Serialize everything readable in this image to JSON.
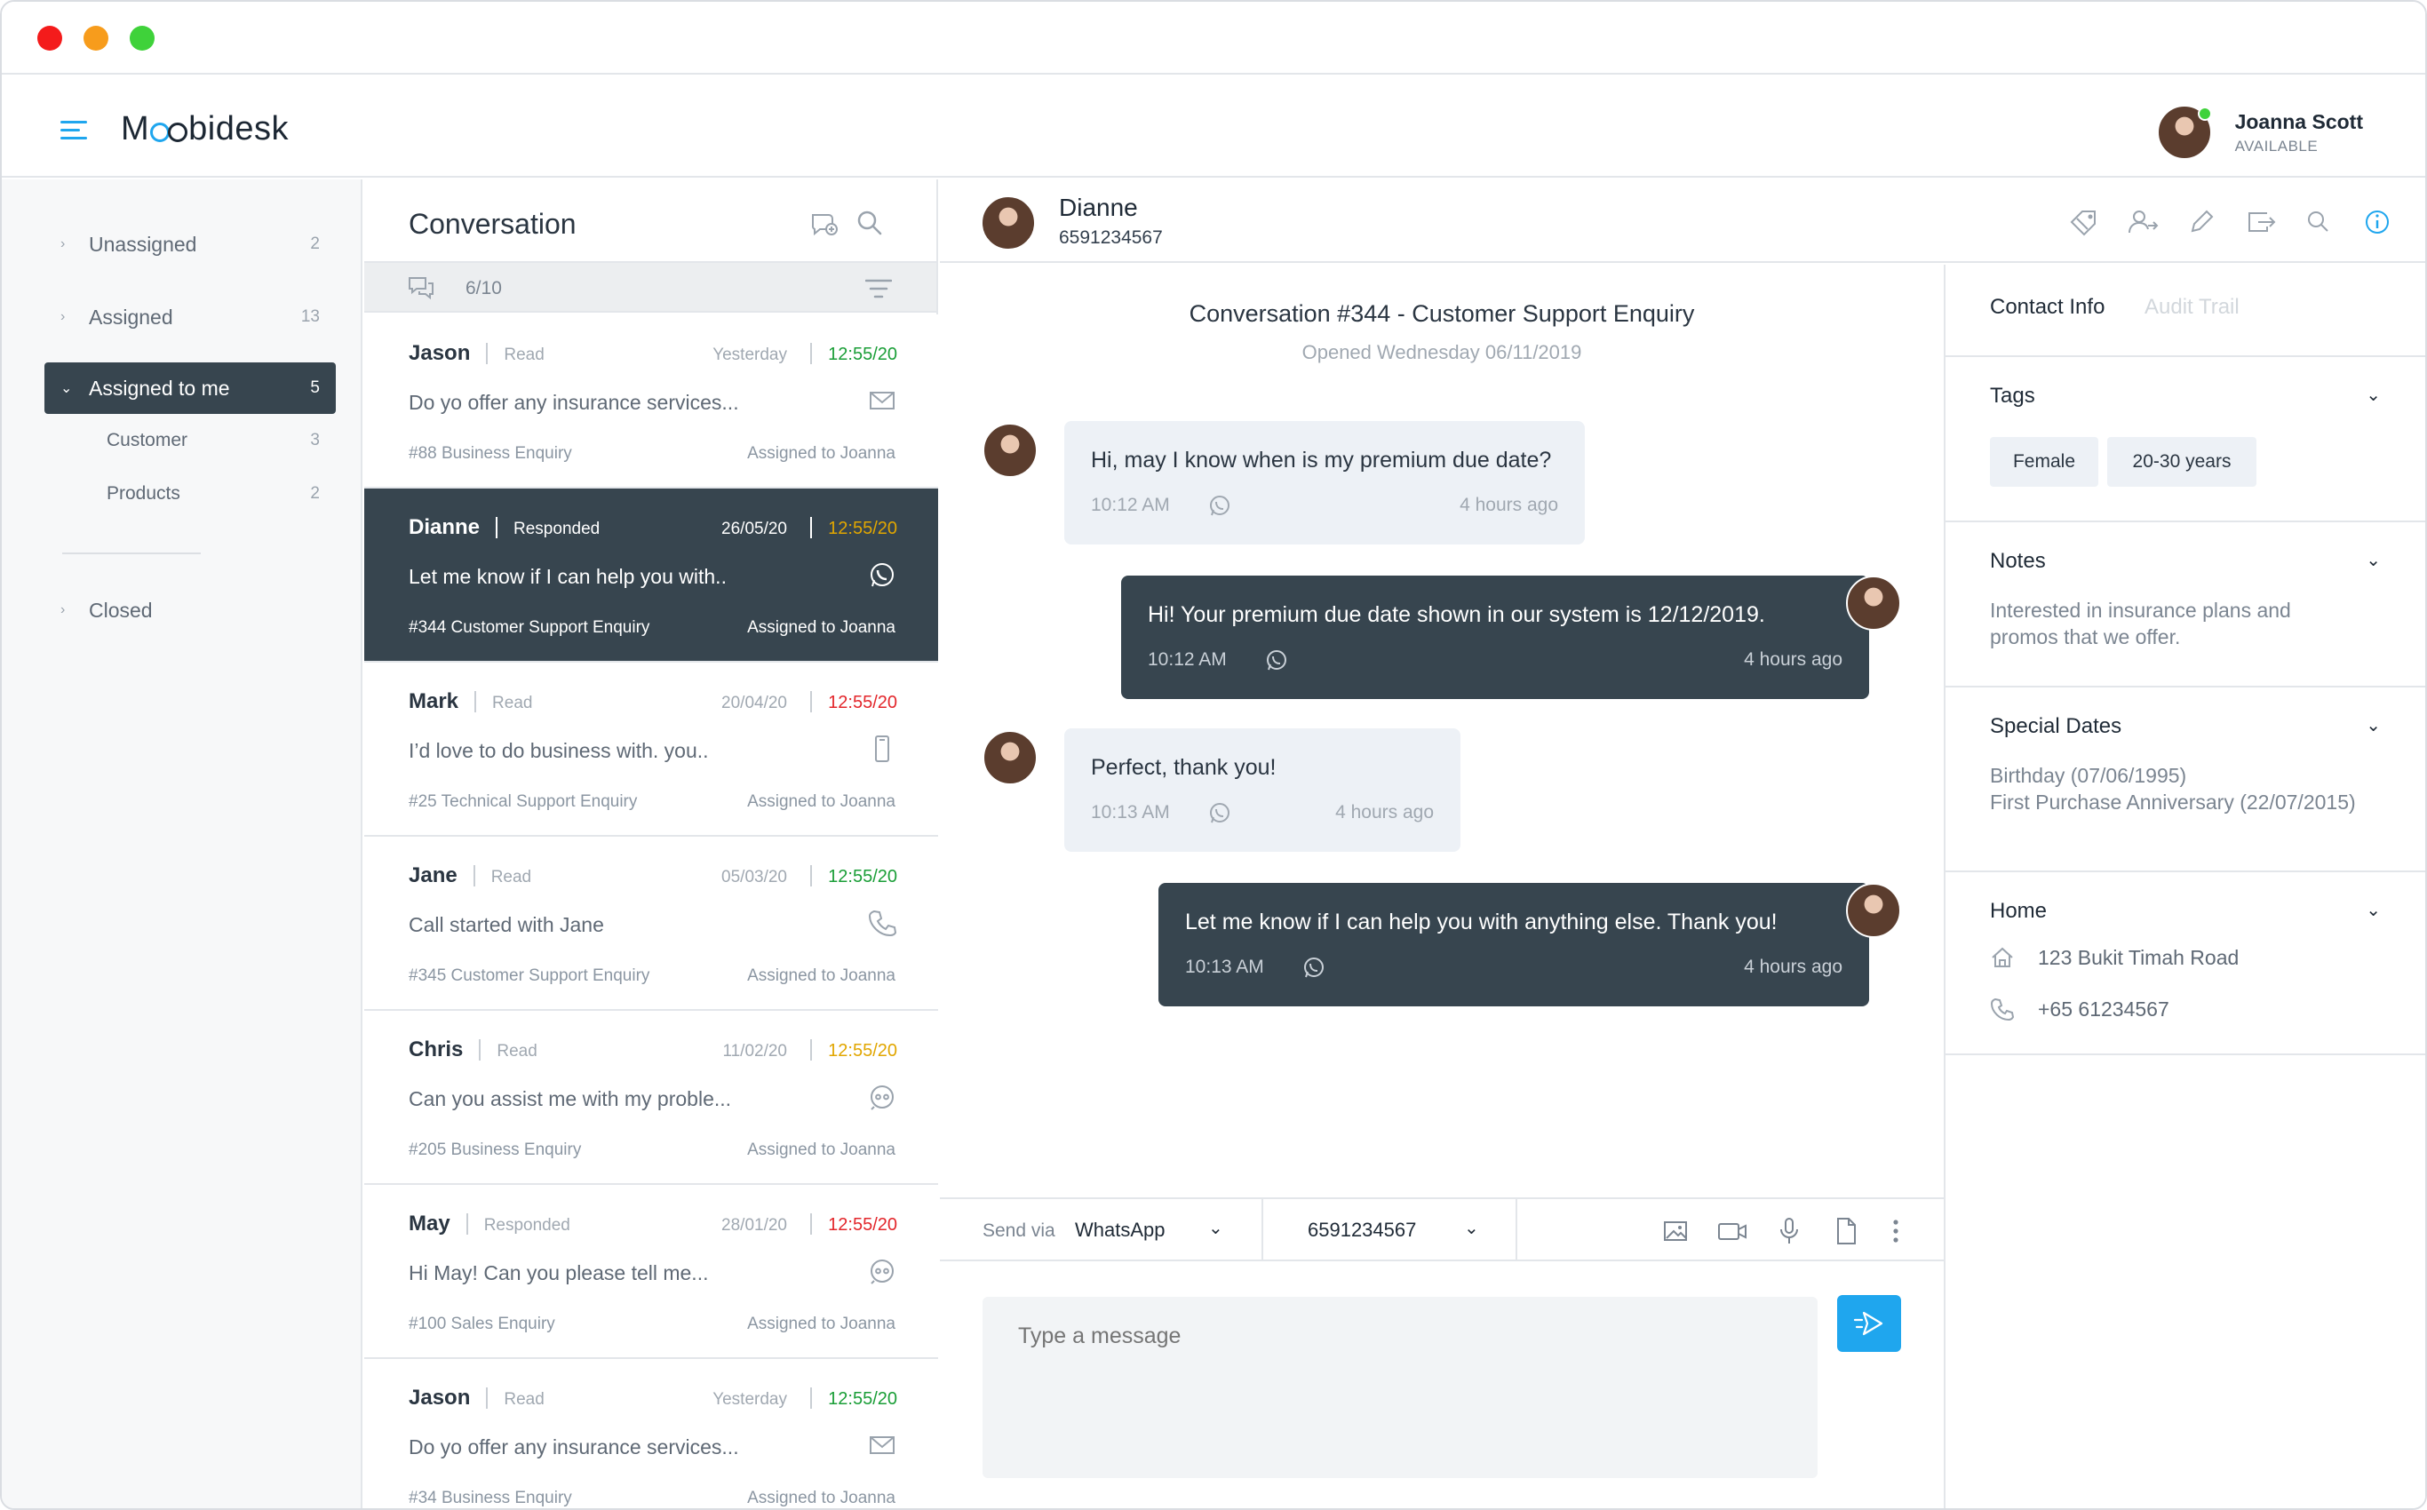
{
  "app": {
    "name": "Moobidesk",
    "logo_start": "M",
    "logo_end": "bidesk"
  },
  "colors": {
    "accent": "#1fa6ee",
    "dark": "#37454f",
    "time_green": "#1a9e37",
    "time_yellow": "#e1a600",
    "time_red": "#e3262b"
  },
  "user": {
    "name": "Joanna Scott",
    "status": "AVAILABLE"
  },
  "sidebar": {
    "items": [
      {
        "label": "Unassigned",
        "count": "2"
      },
      {
        "label": "Assigned",
        "count": "13"
      },
      {
        "label": "Assigned to me",
        "count": "5"
      },
      {
        "label": "Closed",
        "count": ""
      }
    ],
    "subitems": [
      {
        "label": "Customer",
        "count": "3"
      },
      {
        "label": "Products",
        "count": "2"
      }
    ]
  },
  "conversations": {
    "title": "Conversation",
    "count": "6/10",
    "cards": [
      {
        "name": "Jason",
        "status": "Read",
        "date": "Yesterday",
        "time": "12:55/20",
        "time_color": "green",
        "message": "Do yo offer any insurance services...",
        "ticket": "#88 Business Enquiry",
        "assigned": "Assigned to Joanna",
        "channel_icon": "mail-icon"
      },
      {
        "name": "Dianne",
        "status": "Responded",
        "date": "26/05/20",
        "time": "12:55/20",
        "time_color": "yellow",
        "message": "Let me know if I can help you with..",
        "ticket": "#344 Customer Support Enquiry",
        "assigned": "Assigned to Joanna",
        "channel_icon": "whatsapp-icon"
      },
      {
        "name": "Mark",
        "status": "Read",
        "date": "20/04/20",
        "time": "12:55/20",
        "time_color": "red",
        "message": "I’d love to do business with. you..",
        "ticket": "#25 Technical Support Enquiry",
        "assigned": "Assigned to Joanna",
        "channel_icon": "mobile-icon"
      },
      {
        "name": "Jane",
        "status": "Read",
        "date": "05/03/20",
        "time": "12:55/20",
        "time_color": "green",
        "message": "Call started with Jane",
        "ticket": "#345 Customer Support Enquiry",
        "assigned": "Assigned to Joanna",
        "channel_icon": "phone-icon"
      },
      {
        "name": "Chris",
        "status": "Read",
        "date": "11/02/20",
        "time": "12:55/20",
        "time_color": "yellow",
        "message": "Can you assist me with my proble...",
        "ticket": "#205 Business Enquiry",
        "assigned": "Assigned to Joanna",
        "channel_icon": "chatbot-icon"
      },
      {
        "name": "May",
        "status": "Responded",
        "date": "28/01/20",
        "time": "12:55/20",
        "time_color": "red",
        "message": "Hi May! Can you please tell me...",
        "ticket": "#100 Sales Enquiry",
        "assigned": "Assigned to Joanna",
        "channel_icon": "chatbot-icon"
      },
      {
        "name": "Jason",
        "status": "Read",
        "date": "Yesterday",
        "time": "12:55/20",
        "time_color": "green",
        "message": "Do yo offer any insurance services...",
        "ticket": "#34 Business Enquiry",
        "assigned": "Assigned to Joanna",
        "channel_icon": "mail-icon"
      }
    ]
  },
  "chat": {
    "contact_name": "Dianne",
    "contact_phone": "6591234567",
    "heading": "Conversation #344 - Customer Support Enquiry",
    "opened": "Opened Wednesday 06/11/2019",
    "messages": [
      {
        "dir": "in",
        "text": "Hi, may I know when is my premium due date?",
        "time": "10:12 AM",
        "ago": "4 hours ago"
      },
      {
        "dir": "out",
        "text": "Hi! Your premium due date shown in our system is 12/12/2019.",
        "time": "10:12 AM",
        "ago": "4 hours ago"
      },
      {
        "dir": "in",
        "text": "Perfect, thank you!",
        "time": "10:13 AM",
        "ago": "4 hours ago"
      },
      {
        "dir": "out",
        "text": "Let me know if I can help you with anything else. Thank you!",
        "time": "10:13 AM",
        "ago": "4 hours ago"
      }
    ],
    "composer": {
      "send_via_label": "Send via",
      "channel": "WhatsApp",
      "phone": "6591234567",
      "placeholder": "Type a message"
    }
  },
  "info": {
    "tabs": [
      "Contact Info",
      "Audit Trail"
    ],
    "tags_title": "Tags",
    "tags": [
      "Female",
      "20-30 years"
    ],
    "notes_title": "Notes",
    "notes_line1": "Interested in insurance plans and",
    "notes_line2": "promos that we offer.",
    "dates_title": "Special Dates",
    "dates_line1": "Birthday (07/06/1995)",
    "dates_line2": "First Purchase Anniversary (22/07/2015)",
    "home_title": "Home",
    "address": "123 Bukit Timah Road",
    "phone": "+65 61234567"
  }
}
